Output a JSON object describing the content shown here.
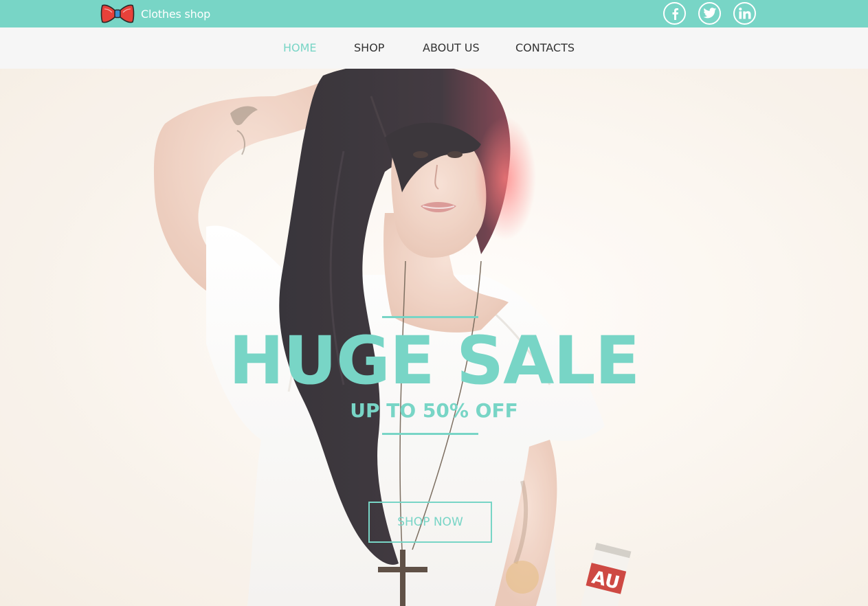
{
  "brand": {
    "name": "Clothes shop",
    "logo_icon": "bow-tie-icon",
    "accent_color": "#78d5c6"
  },
  "socials": [
    {
      "icon": "facebook-icon",
      "label": "f"
    },
    {
      "icon": "twitter-icon"
    },
    {
      "icon": "linkedin-icon",
      "label": "in"
    }
  ],
  "nav": {
    "items": [
      {
        "label": "HOME",
        "active": true
      },
      {
        "label": "SHOP",
        "active": false
      },
      {
        "label": "ABOUT US",
        "active": false
      },
      {
        "label": "CONTACTS",
        "active": false
      }
    ]
  },
  "hero": {
    "headline": "HUGE SALE",
    "subheadline": "UP TO 50% OFF",
    "cta_label": "SHOP NOW",
    "image": "woman-in-white-t-shirt-photo"
  }
}
